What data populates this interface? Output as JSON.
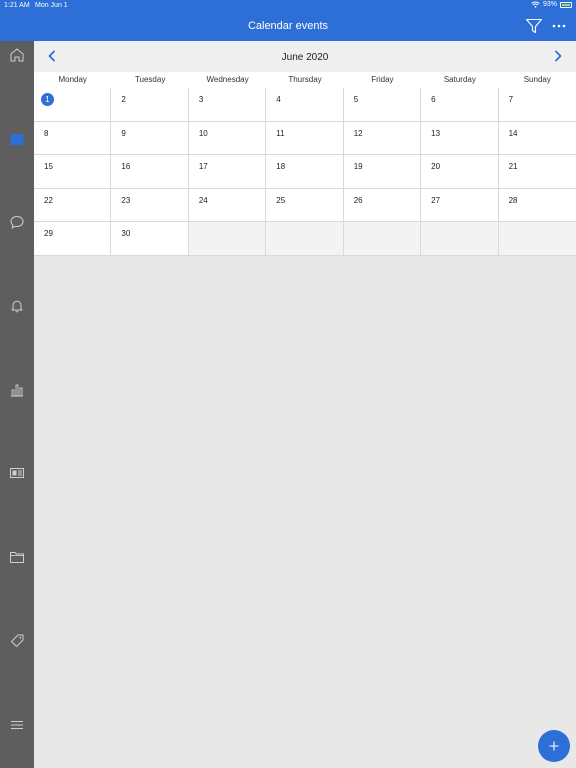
{
  "status": {
    "time": "1:21 AM",
    "date": "Mon Jun 1",
    "battery": "93%"
  },
  "header": {
    "title": "Calendar events"
  },
  "calendar": {
    "month_label": "June 2020",
    "weekdays": [
      "Monday",
      "Tuesday",
      "Wednesday",
      "Thursday",
      "Friday",
      "Saturday",
      "Sunday"
    ],
    "today": "1",
    "days": [
      "1",
      "2",
      "3",
      "4",
      "5",
      "6",
      "7",
      "8",
      "9",
      "10",
      "11",
      "12",
      "13",
      "14",
      "15",
      "16",
      "17",
      "18",
      "19",
      "20",
      "21",
      "22",
      "23",
      "24",
      "25",
      "26",
      "27",
      "28",
      "29",
      "30",
      "",
      "",
      "",
      "",
      ""
    ]
  },
  "sidebar": {
    "items": [
      {
        "icon": "home-icon"
      },
      {
        "icon": "calendar-icon",
        "active": true
      },
      {
        "icon": "chat-icon"
      },
      {
        "icon": "bell-icon"
      },
      {
        "icon": "bar-chart-icon"
      },
      {
        "icon": "news-icon"
      },
      {
        "icon": "folder-icon"
      },
      {
        "icon": "tag-icon"
      },
      {
        "icon": "menu-icon"
      }
    ]
  },
  "colors": {
    "accent": "#2d6fd6",
    "sidebar": "#5e5e5e",
    "background": "#e8e8e8"
  }
}
